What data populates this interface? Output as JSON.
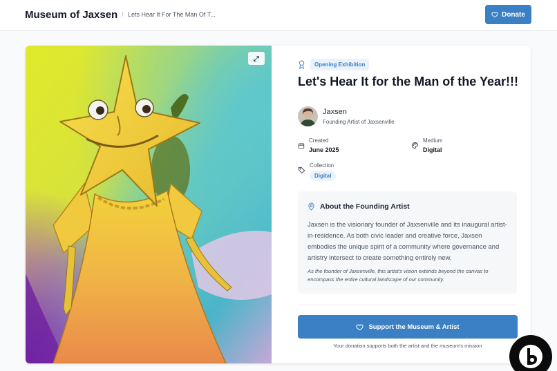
{
  "header": {
    "brand": "Museum of Jaxsen",
    "breadcrumb_sep": "/",
    "breadcrumb": "Lets Hear It For The Man Of T...",
    "donate_label": "Donate"
  },
  "artwork": {
    "badge": "Opening Exhibition",
    "title": "Let's Hear It for the Man of the Year!!!",
    "artist_name": "Jaxsen",
    "artist_role": "Founding Artist of Jaxsenville",
    "created_label": "Created",
    "created_value": "June 2025",
    "medium_label": "Medium",
    "medium_value": "Digital",
    "collection_label": "Collection",
    "collection_value": "Digital"
  },
  "about": {
    "heading": "About the Founding Artist",
    "paragraph": "Jaxsen is the visionary founder of Jaxsenville and its inaugural artist-in-residence. As both civic leader and creative force, Jaxsen embodies the unique spirit of a community where governance and artistry intersect to create something entirely new.",
    "note": "As the founder of Jaxsenville, this artist's vision extends beyond the canvas to encompass the entire cultural landscape of our community."
  },
  "cta": {
    "support_label": "Support the Museum & Artist",
    "support_note": "Your donation supports both the artist and the museum's mission"
  },
  "colors": {
    "accent": "#3b7fc4",
    "accent_light": "#eaf2fb"
  },
  "icons": {
    "donate": "heart-icon",
    "expand": "expand-icon",
    "badge": "award-icon",
    "created": "calendar-icon",
    "medium": "palette-icon",
    "collection": "tag-icon",
    "about": "map-pin-icon",
    "support": "heart-icon"
  }
}
